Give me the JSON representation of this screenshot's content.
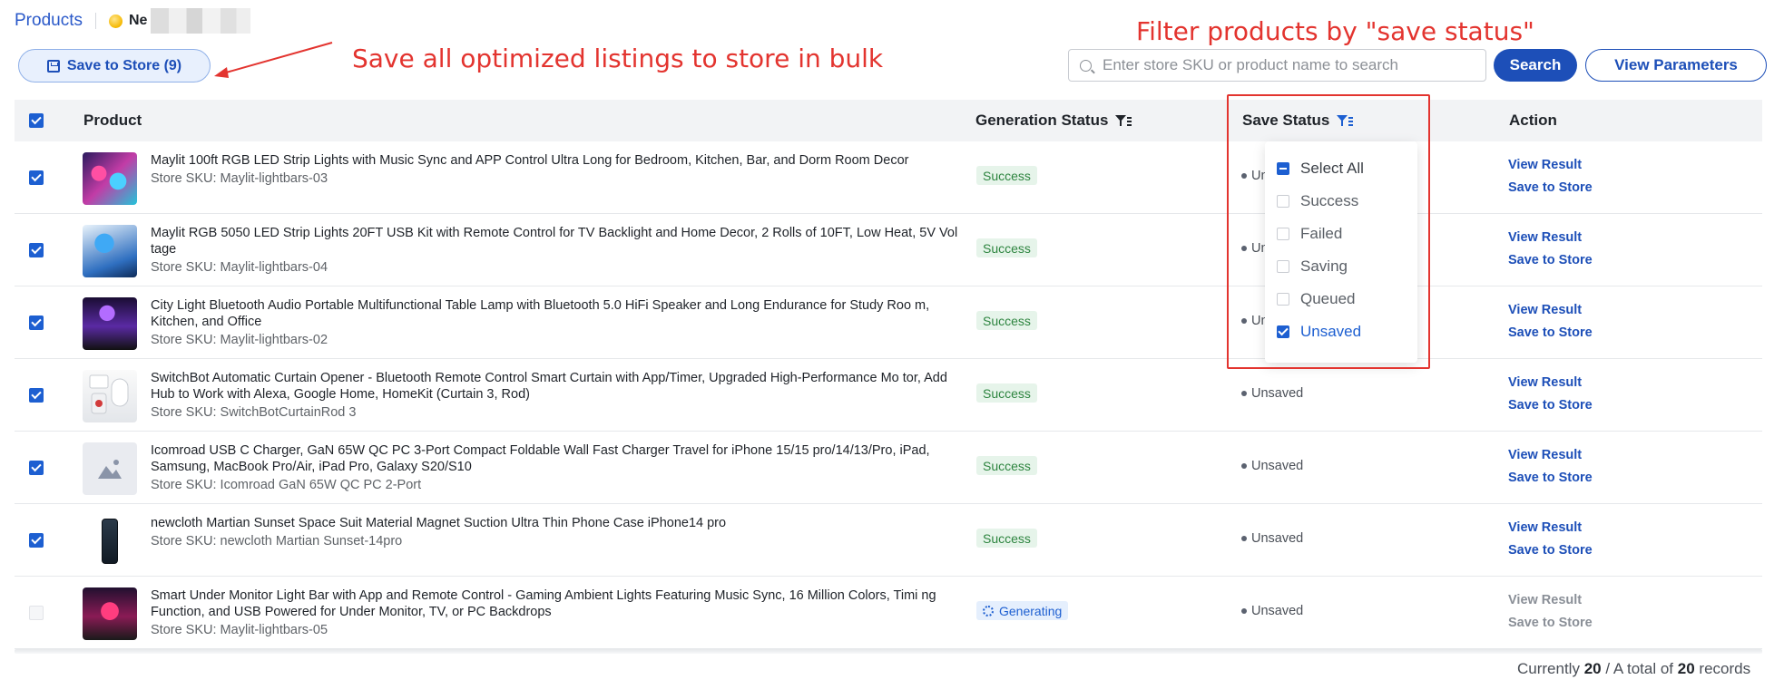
{
  "header": {
    "title": "Products",
    "store_name_prefix": "Ne"
  },
  "annotations": {
    "bulk_save": "Save all optimized listings to store in bulk",
    "filter": "Filter products by \"save status\""
  },
  "toolbar": {
    "save_to_store_label": "Save to Store (9)",
    "search_placeholder": "Enter store SKU or product name to search",
    "search_label": "Search",
    "view_parameters_label": "View Parameters"
  },
  "table": {
    "columns": {
      "product": "Product",
      "generation_status": "Generation Status",
      "save_status": "Save Status",
      "action": "Action"
    },
    "rows": [
      {
        "title": "Maylit 100ft RGB LED Strip Lights with Music Sync and APP Control Ultra Long for Bedroom, Kitchen, Bar, and Dorm Room Decor",
        "sku": "Store SKU: Maylit-lightbars-03",
        "generation_status": "Success",
        "save_status": "Un",
        "view_result": "View Result",
        "save_to_store": "Save to Store"
      },
      {
        "title": "Maylit RGB 5050 LED Strip Lights 20FT USB Kit with Remote Control for TV Backlight and Home Decor, 2 Rolls of 10FT, Low Heat, 5V Vol tage",
        "sku": "Store SKU: Maylit-lightbars-04",
        "generation_status": "Success",
        "save_status": "Un",
        "view_result": "View Result",
        "save_to_store": "Save to Store"
      },
      {
        "title": "City Light Bluetooth Audio Portable Multifunctional Table Lamp with Bluetooth 5.0 HiFi Speaker and Long Endurance for Study Roo m, Kitchen, and Office",
        "sku": "Store SKU: Maylit-lightbars-02",
        "generation_status": "Success",
        "save_status": "Un",
        "view_result": "View Result",
        "save_to_store": "Save to Store"
      },
      {
        "title": "SwitchBot Automatic Curtain Opener - Bluetooth Remote Control Smart Curtain with App/Timer, Upgraded High-Performance Mo tor, Add Hub to Work with Alexa, Google Home, HomeKit (Curtain 3, Rod)",
        "sku": "Store SKU: SwitchBotCurtainRod 3",
        "generation_status": "Success",
        "save_status": "Unsaved",
        "view_result": "View Result",
        "save_to_store": "Save to Store"
      },
      {
        "title": "Icomroad USB C Charger, GaN 65W QC PC 3-Port Compact Foldable Wall Fast Charger Travel for iPhone 15/15 pro/14/13/Pro, iPad, Samsung, MacBook Pro/Air, iPad Pro, Galaxy S20/S10",
        "sku": "Store SKU: Icomroad GaN 65W QC PC 2-Port",
        "generation_status": "Success",
        "save_status": "Unsaved",
        "view_result": "View Result",
        "save_to_store": "Save to Store"
      },
      {
        "title": "newcloth Martian Sunset Space Suit Material Magnet Suction Ultra Thin Phone Case iPhone14 pro",
        "sku": "Store SKU: newcloth Martian Sunset-14pro",
        "generation_status": "Success",
        "save_status": "Unsaved",
        "view_result": "View Result",
        "save_to_store": "Save to Store"
      },
      {
        "title": "Smart Under Monitor Light Bar with App and Remote Control - Gaming Ambient Lights Featuring Music Sync, 16 Million Colors, Timi ng Function, and USB Powered for Under Monitor, TV, or PC Backdrops",
        "sku": "Store SKU: Maylit-lightbars-05",
        "generation_status": "Generating",
        "save_status": "Unsaved",
        "view_result": "View Result",
        "save_to_store": "Save to Store"
      }
    ]
  },
  "filter_dropdown": {
    "options": [
      "Select All",
      "Success",
      "Failed",
      "Saving",
      "Queued",
      "Unsaved"
    ],
    "selected": "Unsaved"
  },
  "footer": {
    "prefix": "Currently",
    "current": "20",
    "middle": "/ A total of",
    "total": "20",
    "suffix": "records"
  },
  "colors": {
    "accent": "#1d4fb8",
    "annotation": "#e3342f",
    "success_bg": "#e6f4ea",
    "success_text": "#2e8540"
  }
}
